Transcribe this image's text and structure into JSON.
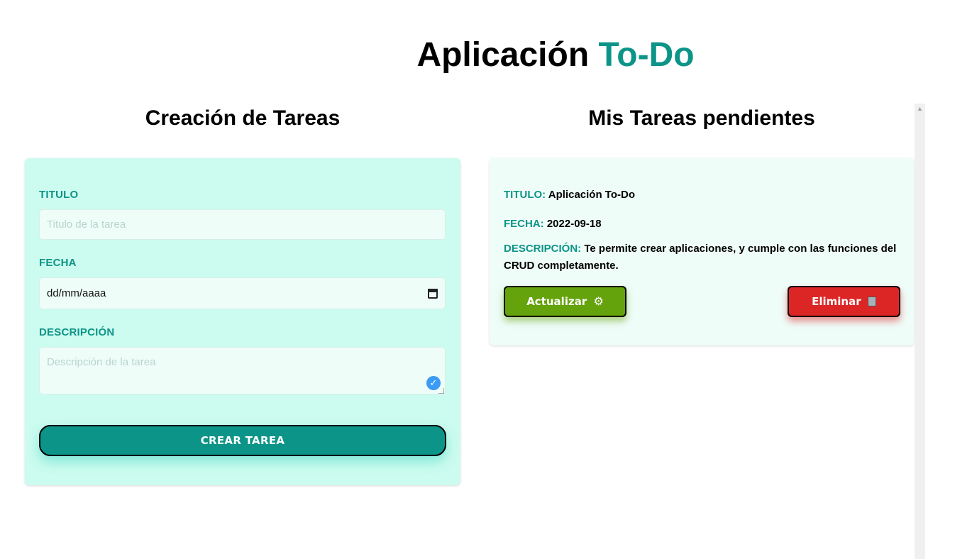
{
  "header": {
    "title_main": "Aplicación",
    "title_accent": "To-Do"
  },
  "form": {
    "section_title": "Creación de Tareas",
    "title_label": "TITULO",
    "title_placeholder": "Titulo de la tarea",
    "date_label": "FECHA",
    "date_value": "dd/mm/aaaa",
    "description_label": "DESCRIPCIÓN",
    "description_placeholder": "Descripción de la tarea",
    "create_button": "CREAR TAREA"
  },
  "tasks": {
    "section_title": "Mis Tareas pendientes",
    "items": [
      {
        "title_key": "TITULO:",
        "title_value": "Aplicación To-Do",
        "date_key": "FECHA:",
        "date_value": "2022-09-18",
        "description_key": "DESCRIPCIÓN:",
        "description_value": "Te permite crear aplicaciones, y cumple con las funciones del CRUD completamente.",
        "update_button": "Actualizar",
        "delete_button": "Eliminar"
      }
    ]
  },
  "colors": {
    "accent": "#0d9488",
    "form_bg": "#ccfbef",
    "card_bg": "#effdf9",
    "update": "#65a30d",
    "delete": "#dc2626"
  },
  "icons": {
    "date_picker": "calendar-icon",
    "grammar_check": "check-icon",
    "update": "gear-icon",
    "delete": "trash-icon"
  }
}
